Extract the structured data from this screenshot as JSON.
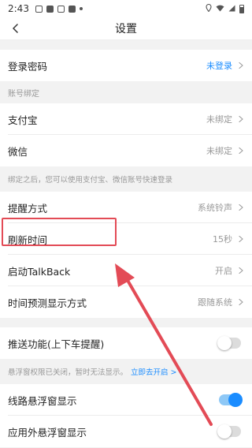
{
  "status_bar": {
    "time": "2:43",
    "colors": {
      "icon": "#555555"
    }
  },
  "navbar": {
    "title": "设置",
    "back_icon": "chevron-left-icon"
  },
  "rows": {
    "login_password": {
      "label": "登录密码",
      "value": "未登录"
    },
    "account_binding_header": "账号绑定",
    "alipay": {
      "label": "支付宝",
      "value": "未绑定"
    },
    "wechat": {
      "label": "微信",
      "value": "未绑定"
    },
    "binding_hint": "绑定之后，您可以使用支付宝、微信账号快速登录",
    "reminder_mode": {
      "label": "提醒方式",
      "value": "系统铃声"
    },
    "refresh_time": {
      "label": "刷新时间",
      "value": "15秒"
    },
    "talkback": {
      "label": "启动TalkBack",
      "value": "开启"
    },
    "time_prediction": {
      "label": "时间预测显示方式",
      "value": "跟随系统"
    },
    "push": {
      "label": "推送功能(上下车提醒)",
      "toggle_on": false
    },
    "float_hint": {
      "text": "悬浮窗权限已关闭，暂时无法显示。",
      "link": "立即去开启 >"
    },
    "route_float": {
      "label": "线路悬浮窗显示",
      "toggle_on": true
    },
    "outside_float": {
      "label": "应用外悬浮窗显示",
      "toggle_on": false
    }
  },
  "annotation": {
    "highlight_color": "#e34b56",
    "arrow_color": "#e34b56"
  },
  "colors": {
    "accent": "#1a8cff",
    "background": "#f2f2f2",
    "muted_text": "#999999"
  }
}
